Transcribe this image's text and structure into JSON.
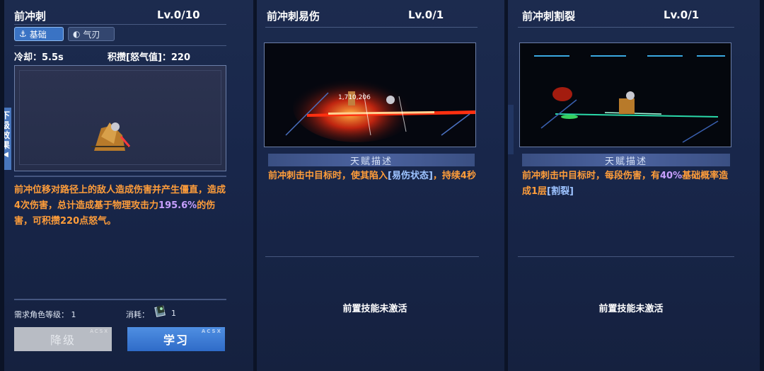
{
  "panel1": {
    "title": "前冲刺",
    "level": "Lv.0/10",
    "tags": [
      {
        "label": "基础",
        "icon": "anchor-icon"
      },
      {
        "label": "气刃",
        "icon": "blade-icon"
      }
    ],
    "cooldown": "冷却：5.5s",
    "accumulate": "积攒[怒气值]：220",
    "side_tab": "下级效果",
    "description": {
      "part1": "前冲位移对路径上的敌人造成伤害并产生僵直，造成4次伤害，总计造成基于物理攻击力",
      "highlight": "195.6%",
      "part2": "的伤害，可积攒220点怒气。"
    },
    "requirement": "需求角色等级：  1",
    "cost_label": "消耗：",
    "cost_value": "1",
    "btn_downgrade": "降级",
    "btn_learn": "学习",
    "btn_mark": "ACSX"
  },
  "panel2": {
    "title": "前冲刺易伤",
    "level": "Lv.0/1",
    "talent_header": "天赋描述",
    "description": {
      "part1": "前冲刺击中目标时，使其陷入",
      "highlight": "[易伤状态]",
      "part2": "，持续4秒"
    },
    "prereq": "前置技能未激活",
    "hud_numbers": "1,710,206"
  },
  "panel3": {
    "title": "前冲刺割裂",
    "level": "Lv.0/1",
    "talent_header": "天赋描述",
    "description": {
      "part1": "前冲刺击中目标时，每段伤害，有",
      "highlight": "40%",
      "part2": "基础概率造成1层",
      "highlight2": "[割裂]"
    },
    "prereq": "前置技能未激活"
  }
}
